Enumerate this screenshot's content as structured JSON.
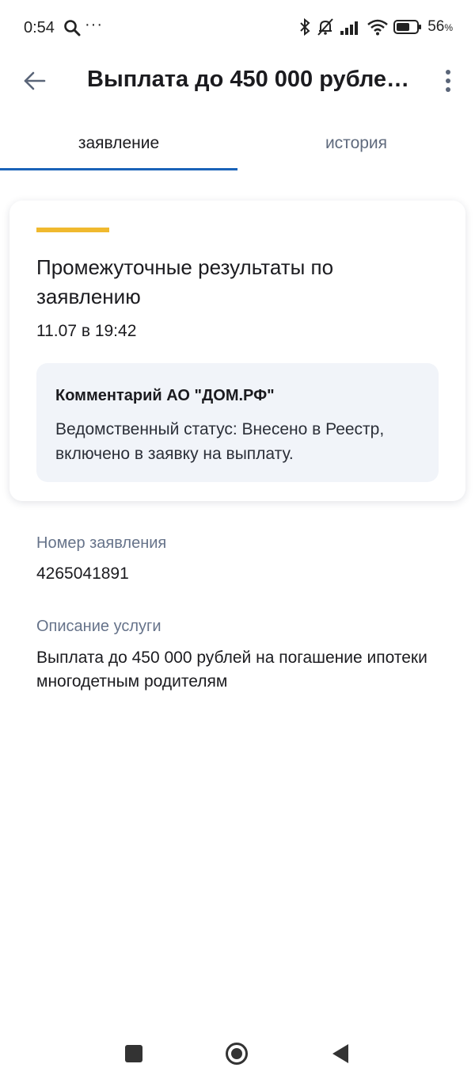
{
  "status_bar": {
    "time": "0:54",
    "more": "···",
    "battery_percent": "56",
    "battery_unit": "%",
    "icons": [
      "search-icon",
      "bluetooth-icon",
      "bell-off-icon",
      "signal-icon",
      "wifi-icon",
      "battery-icon"
    ]
  },
  "app_bar": {
    "title": "Выплата до 450 000 рубле…",
    "icons": [
      "back-arrow-icon",
      "more-vert-icon"
    ]
  },
  "tabs": [
    {
      "label": "заявление",
      "active": true
    },
    {
      "label": "история",
      "active": false
    }
  ],
  "colors": {
    "accent_blue": "#1a63b8",
    "accent_yellow": "#f0b92e",
    "comment_bg": "#f1f4f9",
    "muted_label": "#66738a"
  },
  "status_card": {
    "title": "Промежуточные результаты по заявлению",
    "date": "11.07 в 19:42",
    "comment": {
      "heading": "Комментарий АО \"ДОМ.РФ\"",
      "text": "Ведомственный статус: Внесено в Реестр, включено в заявку на выплату."
    }
  },
  "details": {
    "number_label": "Номер заявления",
    "number_value": "4265041891",
    "description_label": "Описание услуги",
    "description_value": "Выплата до 450 000 рублей на погашение ипотеки многодетным родителям"
  },
  "nav_bar": {
    "icons": [
      "recents-square-icon",
      "home-circle-icon",
      "back-triangle-icon"
    ]
  }
}
